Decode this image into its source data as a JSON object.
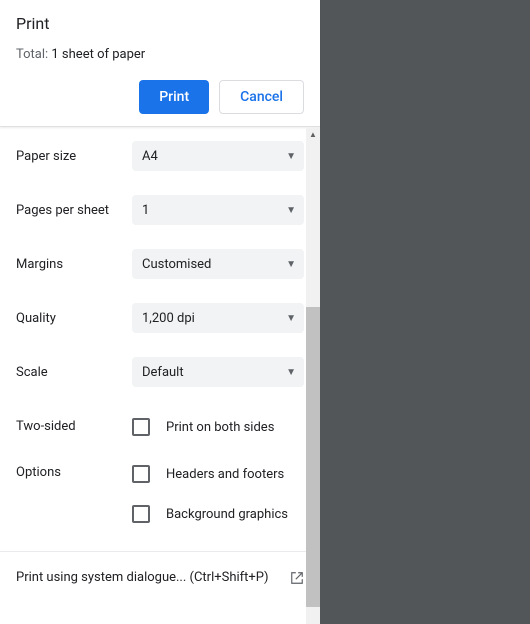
{
  "header": {
    "title": "Print",
    "total_prefix": "Total: ",
    "total_count": "1 sheet of paper",
    "print_label": "Print",
    "cancel_label": "Cancel"
  },
  "settings": {
    "paper_size": {
      "label": "Paper size",
      "value": "A4"
    },
    "pages_per_sheet": {
      "label": "Pages per sheet",
      "value": "1"
    },
    "margins": {
      "label": "Margins",
      "value": "Customised"
    },
    "quality": {
      "label": "Quality",
      "value": "1,200 dpi"
    },
    "scale": {
      "label": "Scale",
      "value": "Default"
    },
    "two_sided": {
      "label": "Two-sided",
      "checkbox_label": "Print on both sides"
    },
    "options": {
      "label": "Options",
      "headers_footers": "Headers and footers",
      "background_graphics": "Background graphics"
    }
  },
  "system_link": {
    "text": "Print using system dialogue... (Ctrl+Shift+P)"
  }
}
